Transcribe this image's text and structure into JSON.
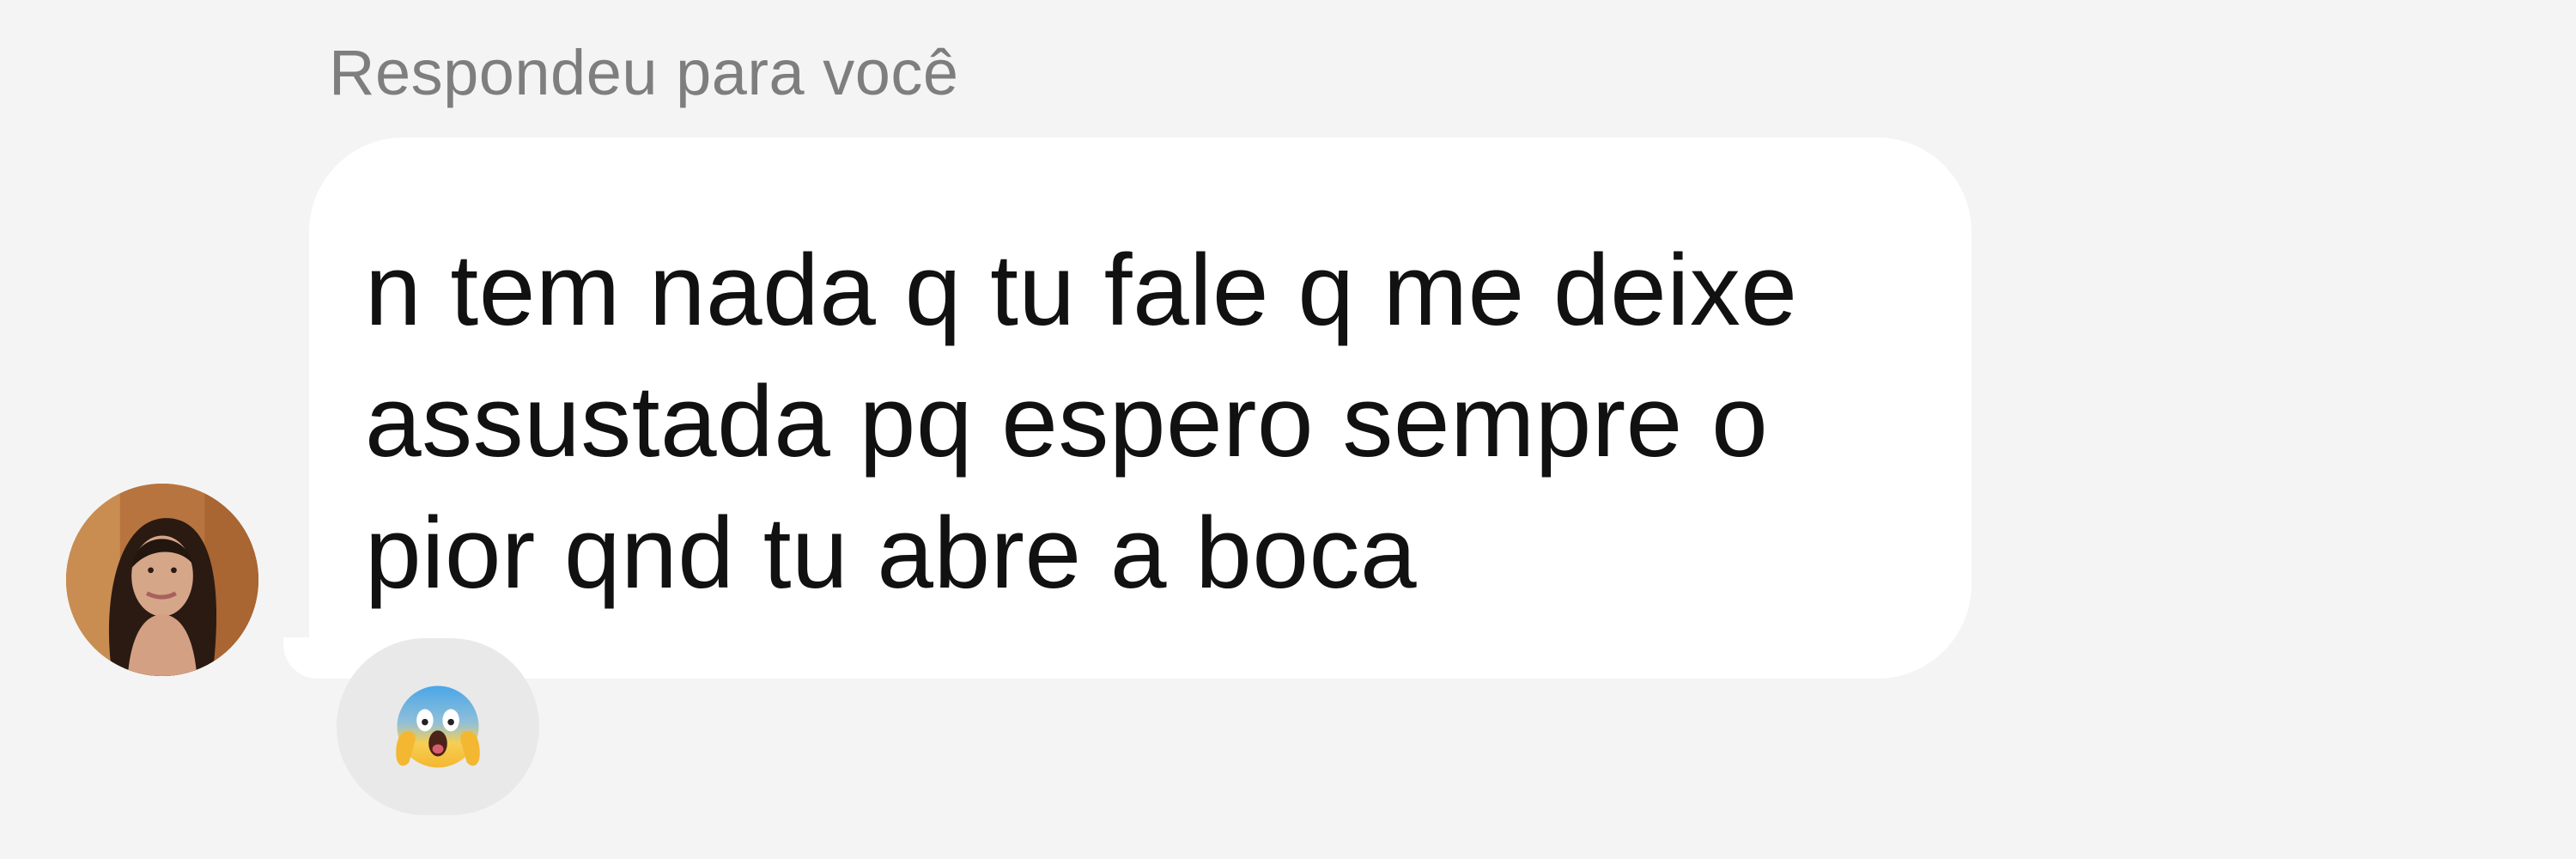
{
  "reply_header": {
    "label": "Respondeu para você"
  },
  "message": {
    "text": "n tem nada q tu fale q me deixe assustada pq espero sempre o pior qnd tu abre a boca"
  },
  "sender": {
    "avatar_icon": "profile-photo"
  },
  "reaction": {
    "emoji_name": "screaming-in-fear-emoji",
    "emoji": "😱"
  }
}
